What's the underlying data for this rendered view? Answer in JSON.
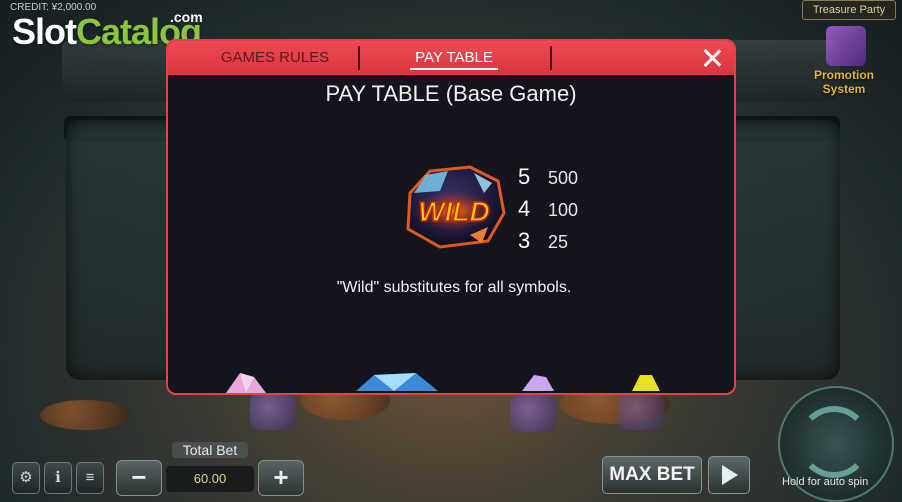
{
  "background": {
    "credit_text": "CREDIT: ¥2,000.00",
    "treasure_button": "Treasure Party",
    "promotion_label": "Promotion System",
    "total_bet_label": "Total Bet",
    "total_bet_value": "60.00",
    "minus_label": "−",
    "plus_label": "+",
    "max_bet_label": "MAX BET",
    "hold_text": "Hold for auto spin"
  },
  "watermark": {
    "part1": "Slot",
    "part2": "Catalog",
    "suffix": ".com"
  },
  "modal": {
    "tabs": [
      {
        "label": "GAMES RULES",
        "active": false
      },
      {
        "label": "PAY TABLE",
        "active": true
      }
    ],
    "title": "PAY TABLE (Base Game)",
    "wild": {
      "symbol_text": "WILD",
      "payouts": [
        {
          "count": "5",
          "value": "500"
        },
        {
          "count": "4",
          "value": "100"
        },
        {
          "count": "3",
          "value": "25"
        }
      ],
      "description": "\"Wild\" substitutes for all symbols."
    }
  },
  "colors": {
    "modal_border": "#e8404a",
    "header": "#e0383f",
    "modal_bg": "#14141f",
    "wild_text": "#ffcc00",
    "wild_glow": "#e03a10"
  }
}
